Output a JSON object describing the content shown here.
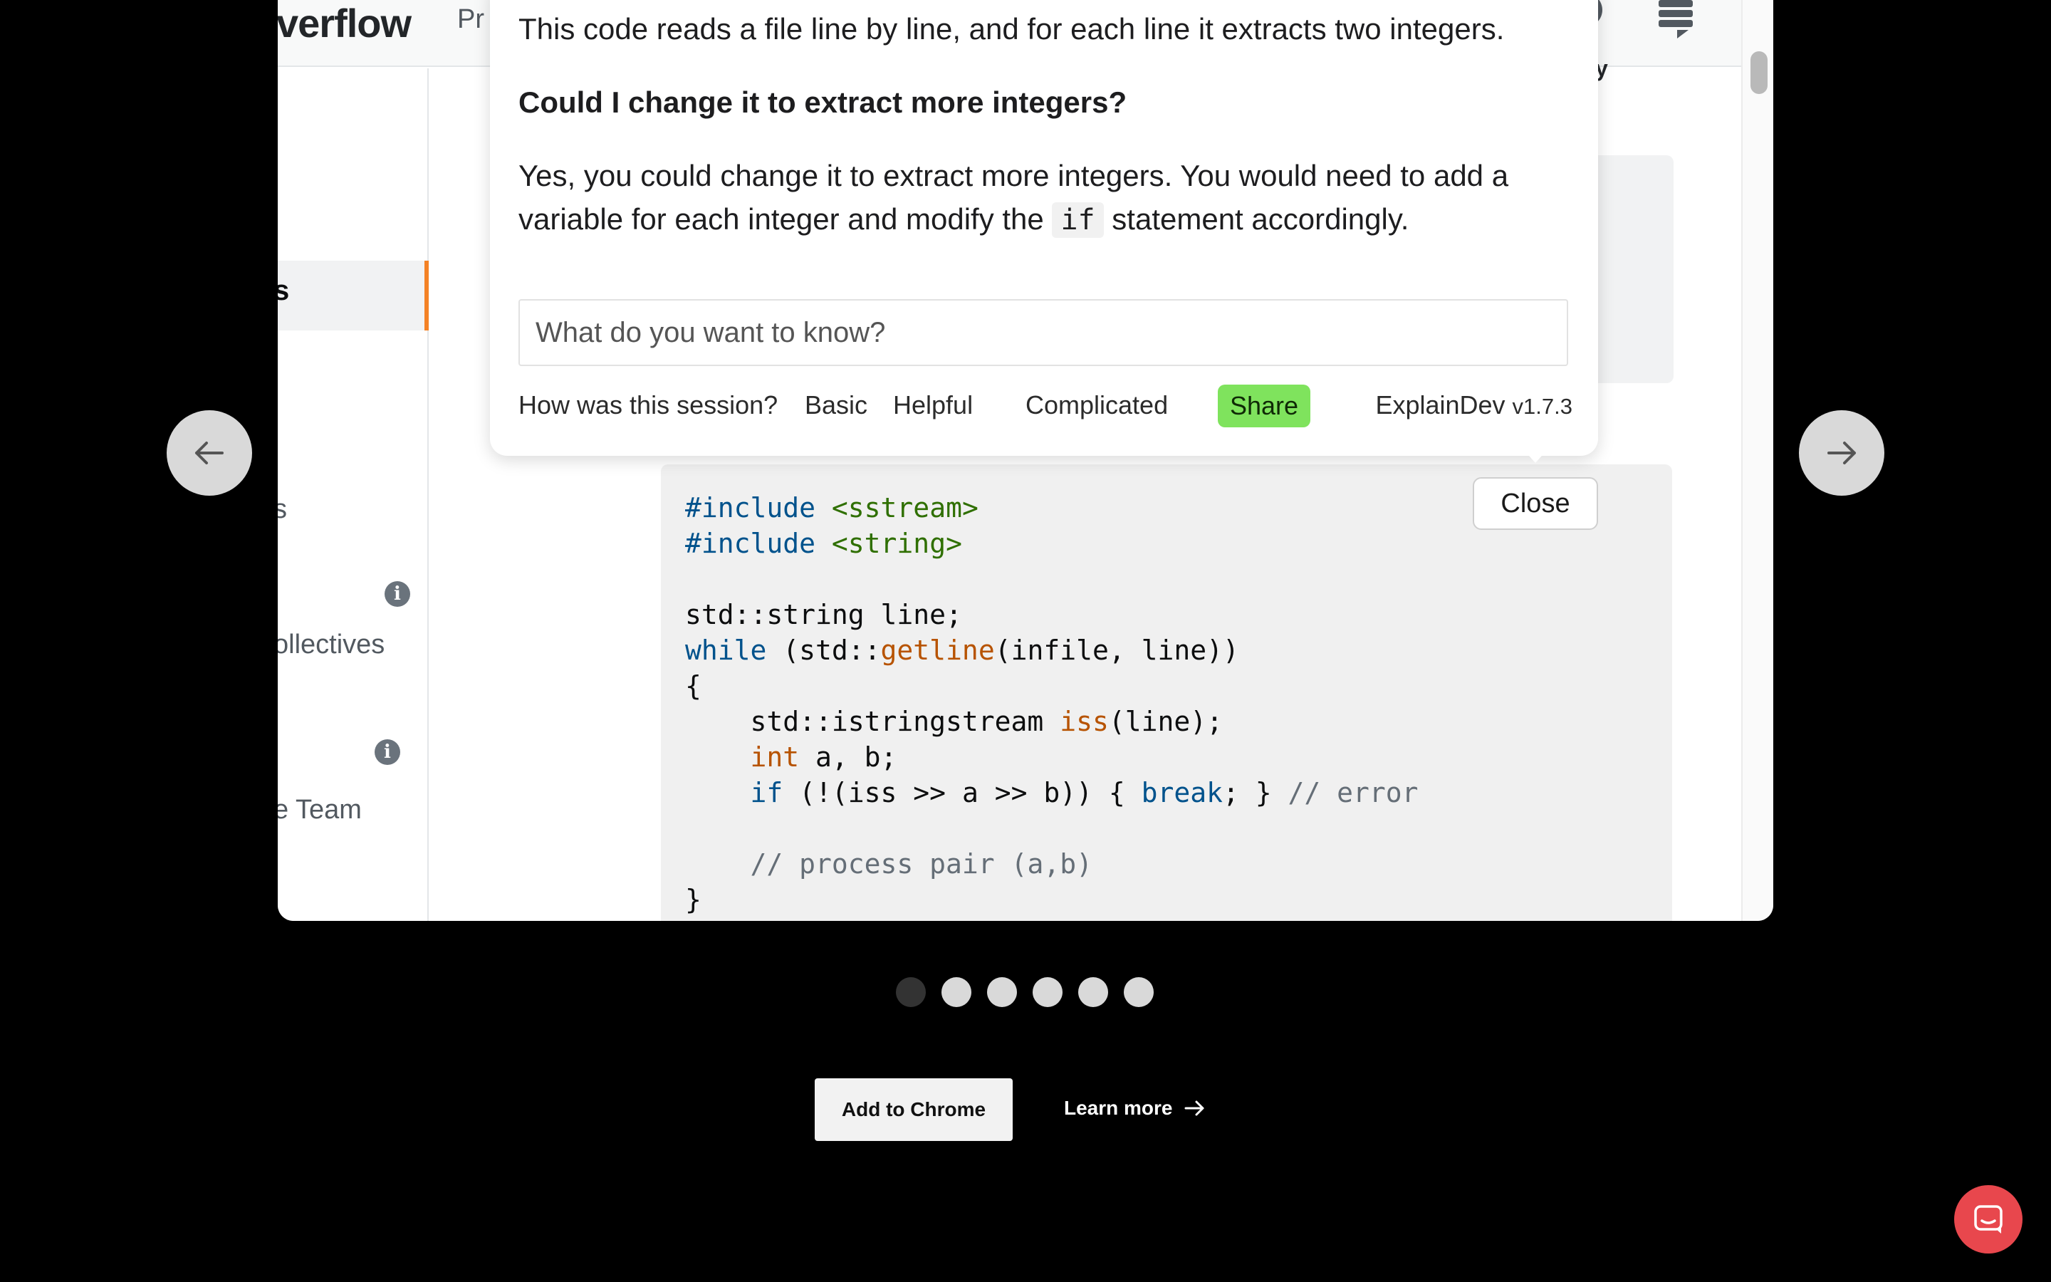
{
  "so_page": {
    "logo_text": "verflow",
    "products_label": "Pr",
    "topright_text": "y",
    "sidebar": {
      "active_item": "s",
      "items": [
        "s",
        "ollectives",
        "e Team"
      ]
    }
  },
  "popup": {
    "intro": "This code reads a file line by line, and for each line it extracts two integers.",
    "question": "Could I change it to extract more integers?",
    "answer_part1": "Yes, you could change it to extract more integers. You would need to add a",
    "answer_part2_pre": "variable for each integer and modify the",
    "answer_code": "if",
    "answer_part2_post": "statement accordingly.",
    "input_placeholder": "What do you want to know?",
    "feedback": {
      "label": "How was this session?",
      "options": [
        "Basic",
        "Helpful",
        "Complicated"
      ],
      "share_label": "Share"
    },
    "brand_name": "ExplainDev",
    "brand_version": "v1.7.3"
  },
  "close_label": "Close",
  "code": {
    "include1_kw": "#include",
    "include1_str": "<sstream>",
    "include2_kw": "#include",
    "include2_str": "<string>",
    "line_decl": "std::string line;",
    "while_kw": "while",
    "while_pre": " (std::",
    "while_fn": "getline",
    "while_post": "(infile, line))",
    "open_brace": "{",
    "iss_pre": "    std::istringstream ",
    "iss_fn": "iss",
    "iss_post": "(line);",
    "int_kw": "int",
    "int_post": " a, b;",
    "if_kw": "if",
    "if_mid": " (!(iss >> a >> b)) { ",
    "break_kw": "break",
    "if_post": "; } ",
    "if_comment": "// error",
    "process_comment": "// process pair (a,b)",
    "close_brace": "}"
  },
  "carousel": {
    "dot_count": 6,
    "active_dot": 0
  },
  "cta": {
    "add_label": "Add to Chrome",
    "learn_label": "Learn more"
  },
  "colors": {
    "share_green": "#7fe35d",
    "chat_red": "#e8474d",
    "so_orange": "#f48225",
    "keyword_blue": "#00528c",
    "string_green": "#2f6f00",
    "function_orange": "#b75301"
  }
}
